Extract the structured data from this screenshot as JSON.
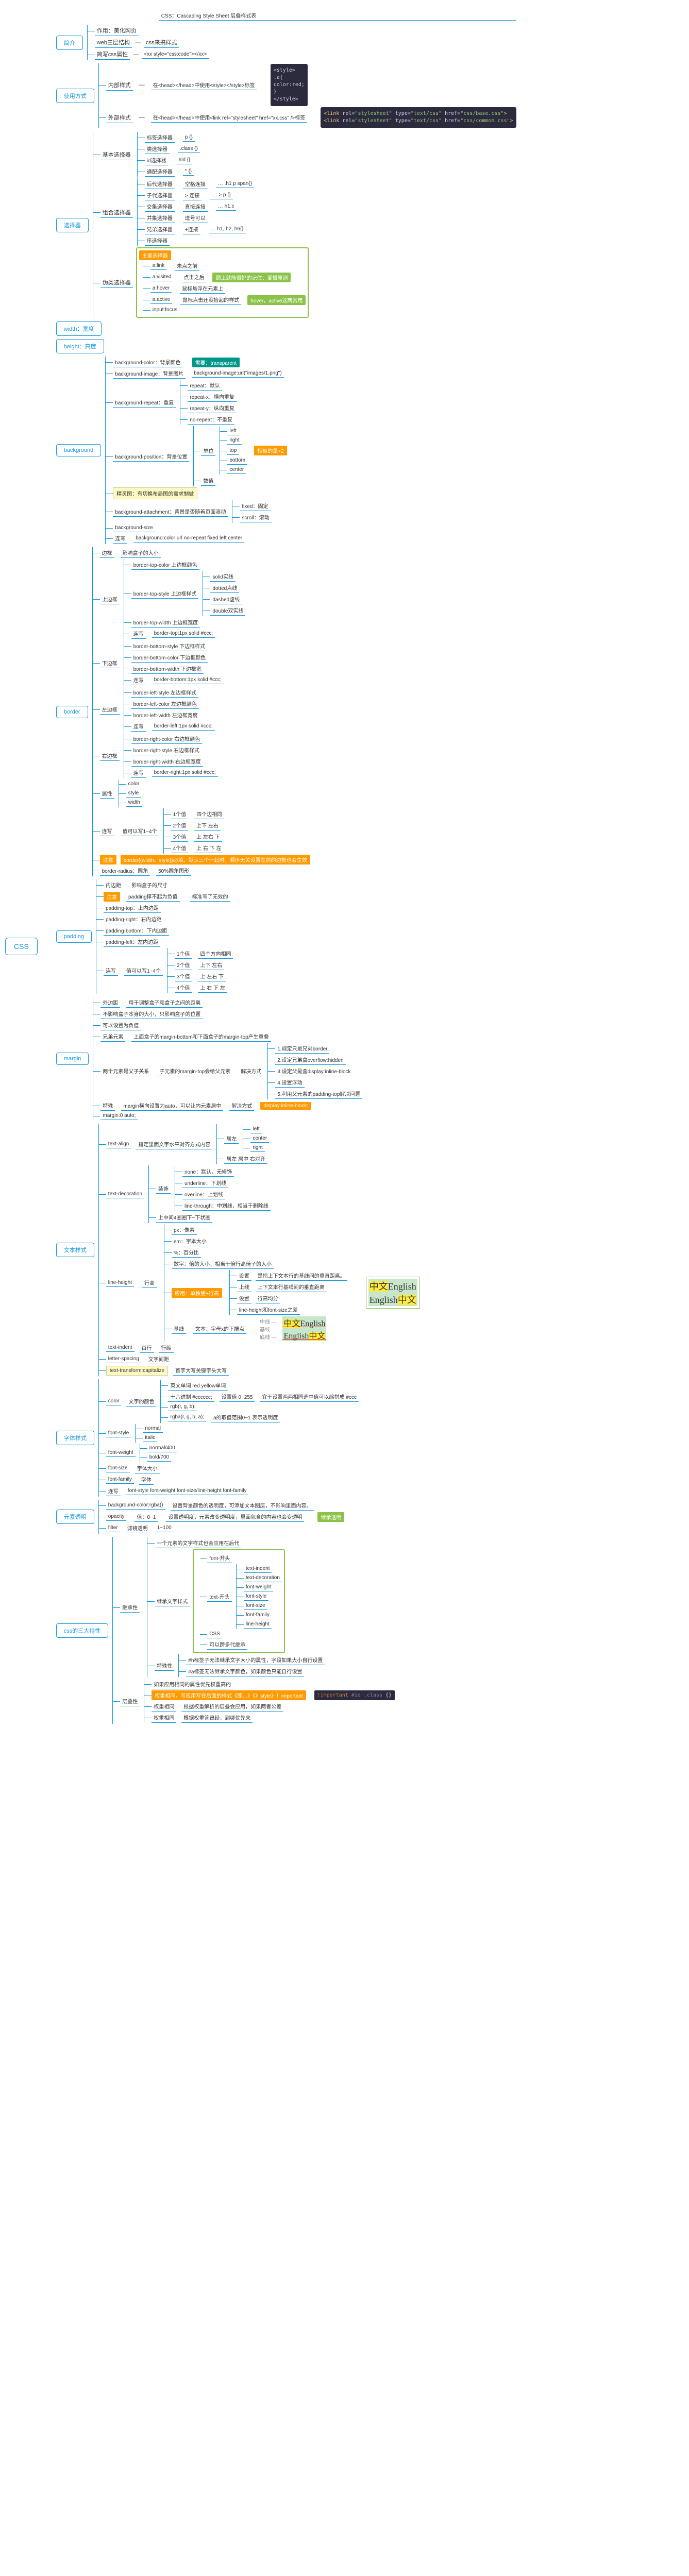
{
  "root": "CSS",
  "title_bar": "CSS：Cascading Style Sheet 层叠样式表",
  "intro": {
    "label": "简介",
    "l1": "作用：美化网页",
    "l2": "web三层结构",
    "l2c": "css来搞样式",
    "l3": "简写css属性",
    "l3c": "<xx style=\"css:code\"></xx>"
  },
  "usage": {
    "label": "使用方式",
    "inline": "内部样式",
    "inline_t": "在<head></head>中使用<style></style>标签",
    "outer": "外部样式",
    "outer_t": "在<head></head>中使用<link rel=\"stylesheet\" href=\"xx.css\" />标签",
    "code1": {
      "l1": "<style>",
      "l2": "  .a{",
      "l3": "    color:red;",
      "l4": "  }",
      "l5": "</style>"
    },
    "code2": {
      "l1": "<link rel=\"stylesheet\" type=\"text/css\" href=\"css/base.css\">",
      "l2": "<link rel=\"stylesheet\" type=\"text/css\" href=\"css/common.css\">"
    }
  },
  "selector": {
    "label": "选择器",
    "basic": "基本选择器",
    "basic_c": [
      [
        "标签选择器",
        "p {}"
      ],
      [
        "类选择器",
        ".class {}"
      ],
      [
        "id选择器",
        "#id {}"
      ],
      [
        "通配选择器",
        "* {}"
      ]
    ],
    "combo": "组合选择器",
    "combo_c": [
      [
        "后代选择器",
        "空格连接",
        "… .h1 p span{}"
      ],
      [
        "子代选择器",
        "> 连接",
        "… > p {}"
      ],
      [
        "交集选择器",
        "直接连接",
        "… h1.c"
      ],
      [
        "并集选择器",
        "逗号可以",
        "",
        " "
      ],
      [
        "兄弟选择器",
        "+连接",
        "… h1, h2, h6{}"
      ],
      [
        "序选择器",
        "",
        "",
        ""
      ]
    ],
    "pseudo": "伪类选择器",
    "pseudo_hl": "主要选择器",
    "pseudo_c": [
      [
        "a:link",
        "未点之前"
      ],
      [
        "a:visited",
        "点击之后"
      ],
      [
        "a:hover",
        "鼠标悬浮在元素上"
      ],
      [
        "a:active",
        "鼠标点击还没抬起的样式"
      ],
      [
        "input:focus",
        ""
      ]
    ],
    "pseudo_note": "顾上就能很好的记住：爱恨原则",
    "pseudo_hover": "hover，active这两常用"
  },
  "width": "width：宽度",
  "height": "height：高度",
  "bg": {
    "label": "background",
    "cc": "background-color：背景颜色",
    "trans": "需要：transparent",
    "img": "background-image：背景图片",
    "img_v": "background-image:url(\"images/1.png\")",
    "rep": "background-repeat：重复",
    "rep_c": [
      "repeat：默认",
      "repeat-x：横向重复",
      "repeat-y：纵向重复",
      "no-repeat：不重复"
    ],
    "pos": "background-position：背景位置",
    "pos_single": "单位",
    "pos_sc": [
      "left",
      "right",
      "top",
      "bottom",
      "center"
    ],
    "pos_tip": "相似的是+2",
    "pos_num": "数值",
    "pos_note": "精灵图：有切换布局图的需求制做",
    "att": "background-attachment：背景是否随着页面滚动",
    "att_c": [
      "fixed：固定",
      "scroll：滚动"
    ],
    "size": "background-size",
    "short": "连写",
    "short_v": "background:color url no-repeat fixed left center"
  },
  "border": {
    "label": "border",
    "mean": "边框",
    "bd_mean": "影响盒子的大小",
    "top": "上边框",
    "top_c": [
      "border-top-color 上边框颜色",
      "border-top-style 上边框样式",
      "border-top-width 上边框宽度",
      "连写",
      "border-top:1px solid #ccc;"
    ],
    "top_style": [
      "solid实线",
      "dotted点线",
      "dashed虚线",
      "double双实线"
    ],
    "bot": "下边框",
    "bot_c": [
      "border-bottom-style 下边框样式",
      "border-bottom-color 下边框颜色",
      "border-bottom-width 下边框宽",
      "连写",
      "border-bottom:1px solid #ccc;"
    ],
    "left": "左边框",
    "left_c": [
      "border-left-style 左边框样式",
      "border-left-color 左边框颜色",
      "border-left-width 左边框宽度",
      "连写",
      "border-left:1px solid #ccc;"
    ],
    "right": "右边框",
    "right_c": [
      "border-right-color 右边框颜色",
      "border-right-style 右边框样式",
      "border-right-width 右边框宽度",
      "连写",
      "border-right:1px solid #ccc;"
    ],
    "attr": "属性",
    "attr_c": [
      "color",
      "style",
      "width"
    ],
    "short": "连写",
    "short_t": "值可以写1~4个",
    "short_c": [
      "1个值",
      "四个边相同",
      "2个值",
      "上下 左右",
      "3个值",
      "上 左右 下",
      "4个值",
      "上 右 下 左"
    ],
    "note": "注意",
    "note_t": "border{{width、style}}必填，默认三个一起时，顺序无关设置在前的边框也会生效",
    "radius": "border-radius：圆角",
    "radius_v": "50%圆角图形"
  },
  "padding": {
    "label": "padding",
    "mean": "内边距",
    "mean2": "影响盒子的尺寸",
    "note": "注意",
    "note_t": "padding撑不起为负值",
    "note_t2": "标准写了无效的",
    "tp": "padding-top：上内边距",
    "rg": "padding-right：右内边距",
    "bt": "padding-bottom：下内边距",
    "lf": "padding-left：左内边距",
    "short": "连写",
    "short_t": "值可以写1~4个",
    "short_c": [
      [
        "1个值",
        "四个方向相同"
      ],
      [
        "2个值",
        "上下 左右"
      ],
      [
        "3个值",
        "上 左右 下"
      ],
      [
        "4个值",
        "上 右 下 左"
      ]
    ]
  },
  "margin": {
    "label": "margin",
    "mean": "外边距",
    "mean2": "用于调整盒子和盒子之间的距离",
    "notin": "不影响盒子本身的大小，只影响盒子的位置",
    "merge": "可以设置为负值",
    "merge_t": "兄弟元素",
    "merge_tt": "上面盒子的margin-bottom和下面盒子的margin-top产生重叠",
    "merge_s": "解决方案",
    "merge_sc": [
      "1.规定只是兄弟border",
      "2.设定兄弟盒overflow:hidden",
      "3.设定父是盒display:inline-block",
      "4.设置浮动",
      "5.利用父元素的padding-top解决问题"
    ],
    "parent": "两个元素是父子关系",
    "parent_t": "子元素的margin-top会给父元素",
    "parent_s": "解决方式",
    "parent_hl": "display:inline-block;",
    "auto": "特殊",
    "auto_t": "margin横向设置为auto，可以让内元素居中",
    "auto_s": "解决方式",
    "auto_t2": "margin:0 auto;"
  },
  "text": {
    "label": "文本样式",
    "align": "text-align",
    "align_t": "指定里面文字水平对齐方式内容",
    "align_c": [
      "居左",
      "left",
      "center",
      "right"
    ],
    "align_r": "居左 居中 右对齐",
    "deco": "text-decoration",
    "deco_t": "装饰",
    "deco_c": [
      "none：默认，无修饰",
      "underline：下划线",
      "overline：上划线",
      "line-through：中划线，相当于删除线"
    ],
    "deco_sub": "上中间4圈圈下~下状圈",
    "lh": "line-height",
    "lh_t": "行高",
    "lh_unit": "px：像素",
    "lh_em": "em：字本大小",
    "lh_num": "%：百分比",
    "lh_nu": "数字：倍的大小，相当于倍行高倍子的大小",
    "lh_app": "应用：单独使+行高",
    "lh_app_hl": "设置",
    "lh_app_t": "是指上下文本行的基线间的垂直距离。",
    "lh_line": "上线",
    "lh_t2": "上下文本行基线间的垂直距离",
    "lh_t3": "设置",
    "lh_t4": "行高均分",
    "lh_t5": "line-height和font-size之差",
    "lh_base": "基线",
    "lh_base_t": "文本：字母x的下端点",
    "indent": "text-indent",
    "indent_t": "首行",
    "indent_t2": "行缩",
    "spacing": "letter-spacing",
    "spacing_t": "文字间距",
    "trans": "text-transform:capitalize",
    "trans_t": "首字大写关键字头大写"
  },
  "font": {
    "label": "字体样式",
    "color": "color",
    "color_t": "文字的颜色",
    "color_c": [
      "英文单词 red yellow单词",
      "十六进制 #cccccc;",
      "设置值 0~255",
      "宜干设置两两相同选中值可以缩拼成 #ccc",
      "rgb(r, g, b);",
      "rgba(r, g, b, a);",
      "a的取值范围0~1 表示透明度"
    ],
    "style": "font-style",
    "style_c": [
      "normal",
      "italic"
    ],
    "weight": "font-weight",
    "weight_c": [
      "normal/400",
      "bold/700"
    ],
    "size": "font-size",
    "size_t": "字体大小",
    "family": "font-family",
    "family_t": "字体",
    "short": "连写",
    "short_t": "font-style font-weight font-size/line-height font-family"
  },
  "opacity": {
    "label": "元素透明",
    "bg": "background-color:rgba()",
    "bg_t": "设置背景颜色的透明度，可添加文本图层，不影响里面内容。",
    "op": "opacity",
    "op_t": "值：0~1",
    "op_t2": "设置透明度，元素改变透明度，里面包含的内容也会变透明",
    "filter": "filter",
    "filter_t": "滤镜透明",
    "filter_v": "1~100",
    "tip": "继承透明"
  },
  "three": {
    "label": "css的三大特性",
    "inherit": "继承性",
    "inherit_t": "一个元素的文字样式也会应用在后代",
    "inherit_list": [
      "继承文字样式",
      "font-开头",
      "text-开头",
      "text-indent",
      "text-decoration",
      "font-weight",
      "font-style",
      "font-size",
      "font-family",
      "line-height",
      "CSS",
      "可以跨多代继承"
    ],
    "inherit_sp": "特殊性",
    "inherit_sp_c": [
      "#h标签子无法继承文字大小的属性，字段如果大小自行设置",
      "#a标签无法继承文字颜色，如果颜色只能自行设置"
    ],
    "cascade": "层叠性",
    "cascade_t": "如果应用相同的属性优先权重高的",
    "cascade_t2": "权重相同，写应用写在后面的样式《即…》《》style》！important",
    "cascade_c": [
      "权重相同",
      "根据权重解析的层叠会应用，如果两者公差",
      "",
      "",
      "权重相同",
      "根据权重答曾经，到哪优先来"
    ],
    "imp": "important"
  }
}
